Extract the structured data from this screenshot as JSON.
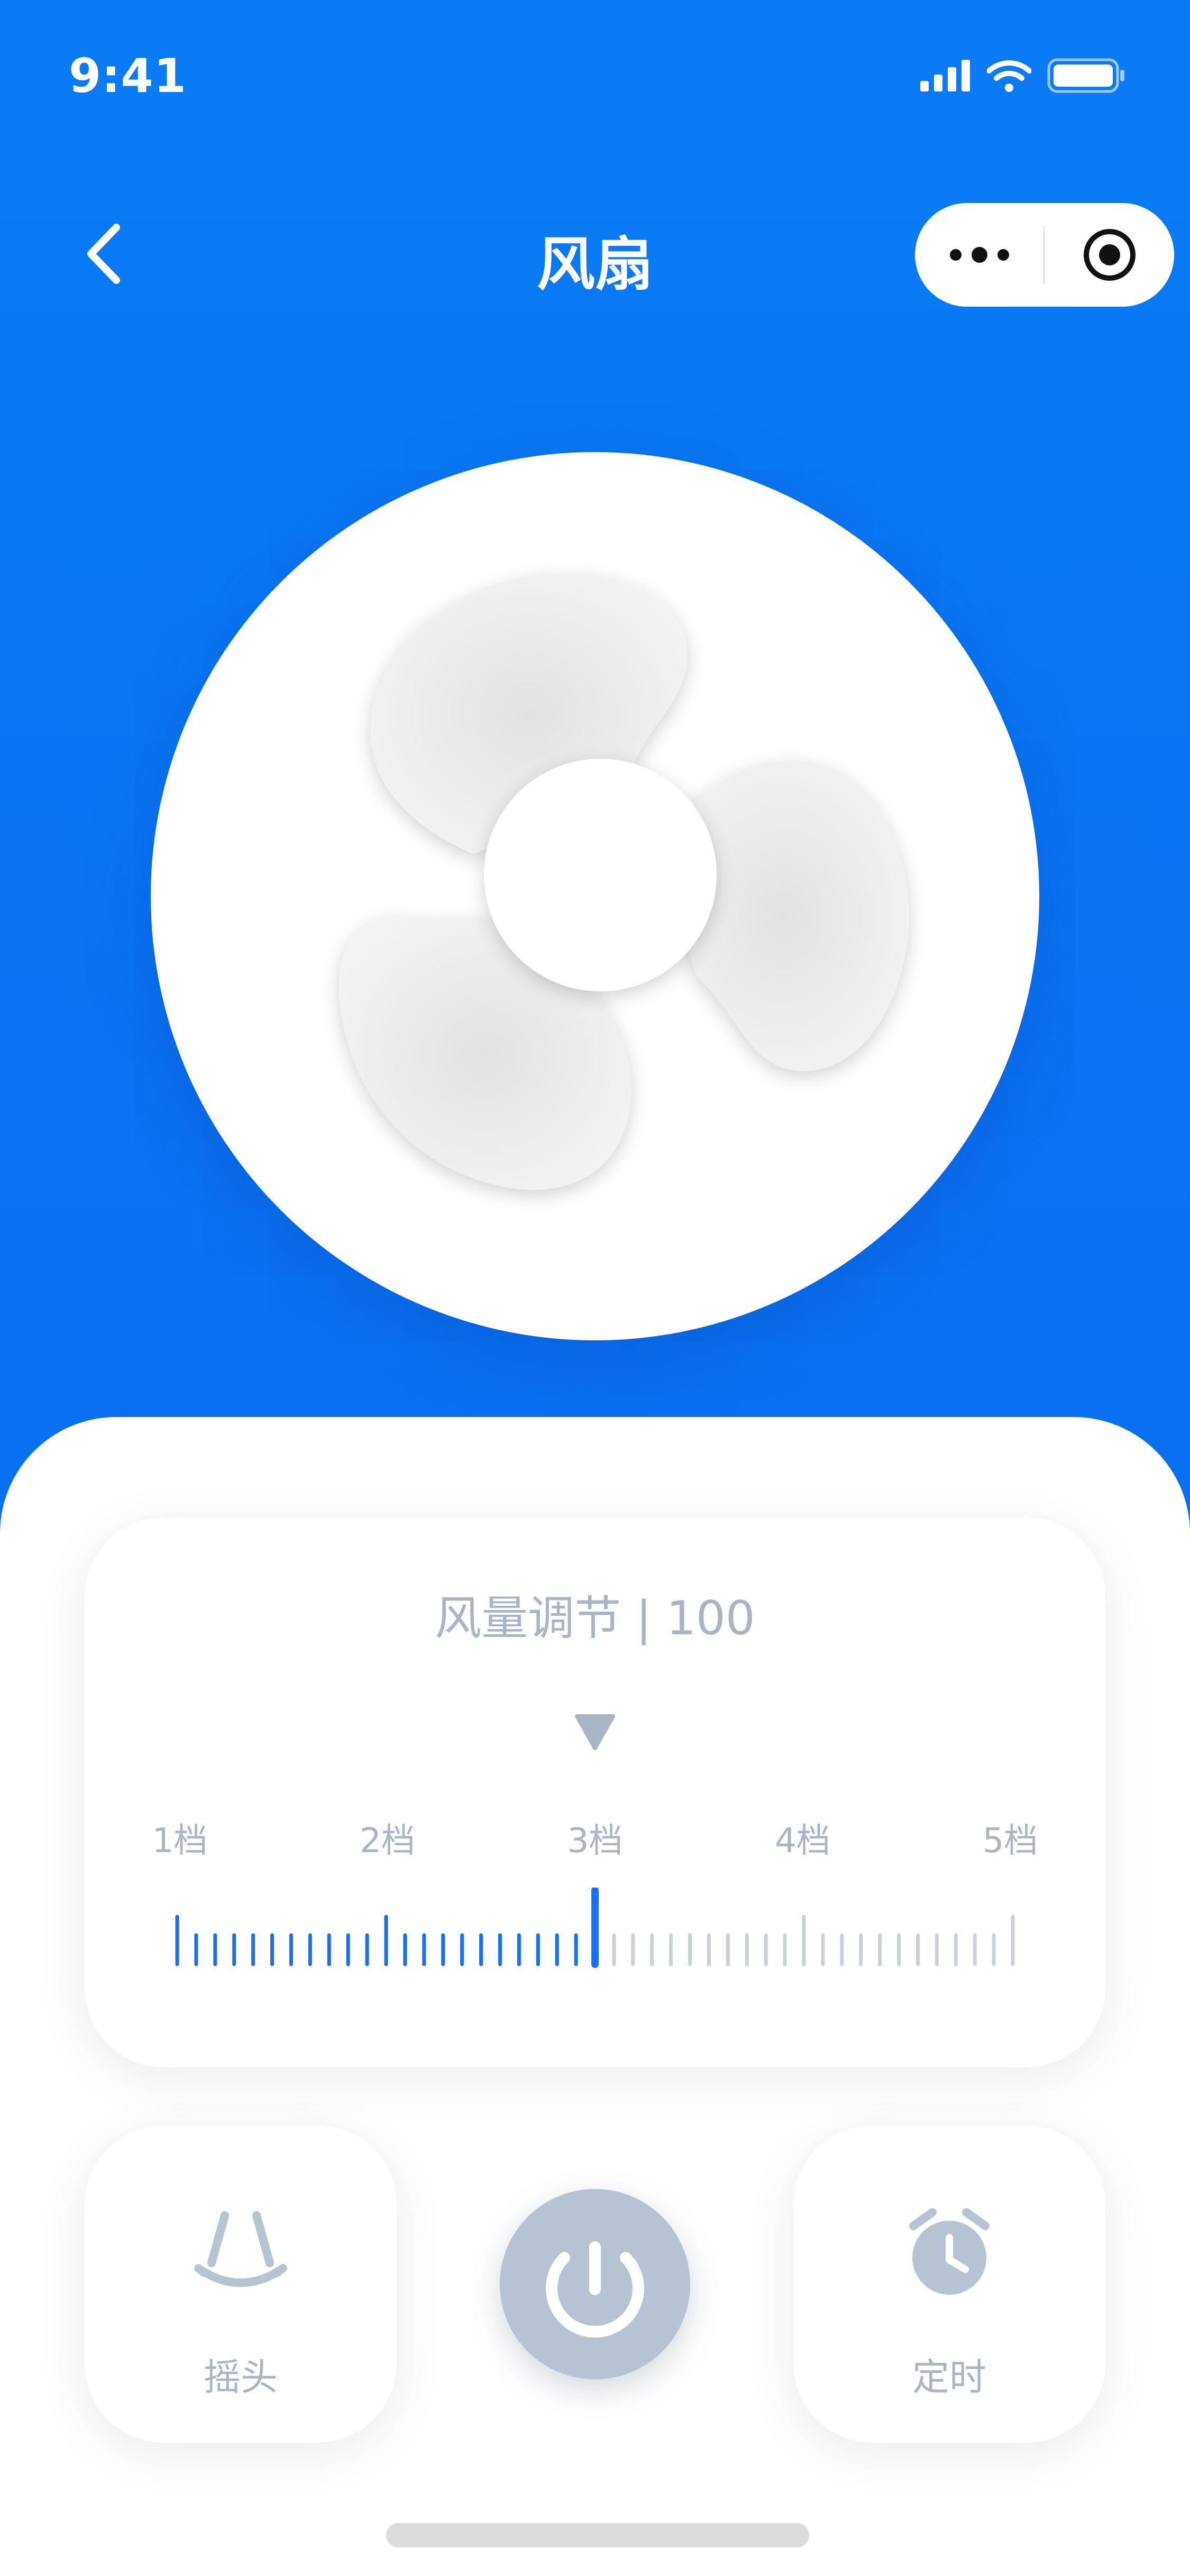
{
  "status_bar": {
    "time": "9:41"
  },
  "nav": {
    "title": "风扇"
  },
  "wind": {
    "title": "风量调节 | 100",
    "gears": [
      "1档",
      "2档",
      "3档",
      "4档",
      "5档"
    ],
    "selected_gear_index": 2,
    "tick_count": 45,
    "selected_tick_index": 22
  },
  "controls": {
    "swing_label": "摇头",
    "timer_label": "定时"
  },
  "colors": {
    "background": "#0a7bf5",
    "accent": "#1a6ff0",
    "inactive": "#b5c3d3",
    "muted_text": "#a9b4c4"
  },
  "icons": {
    "back": "chevron-left-icon",
    "more": "more-dots-icon",
    "target": "target-icon",
    "fan": "fan-blade-icon",
    "swing": "swing-icon",
    "power": "power-icon",
    "timer": "alarm-clock-icon"
  }
}
